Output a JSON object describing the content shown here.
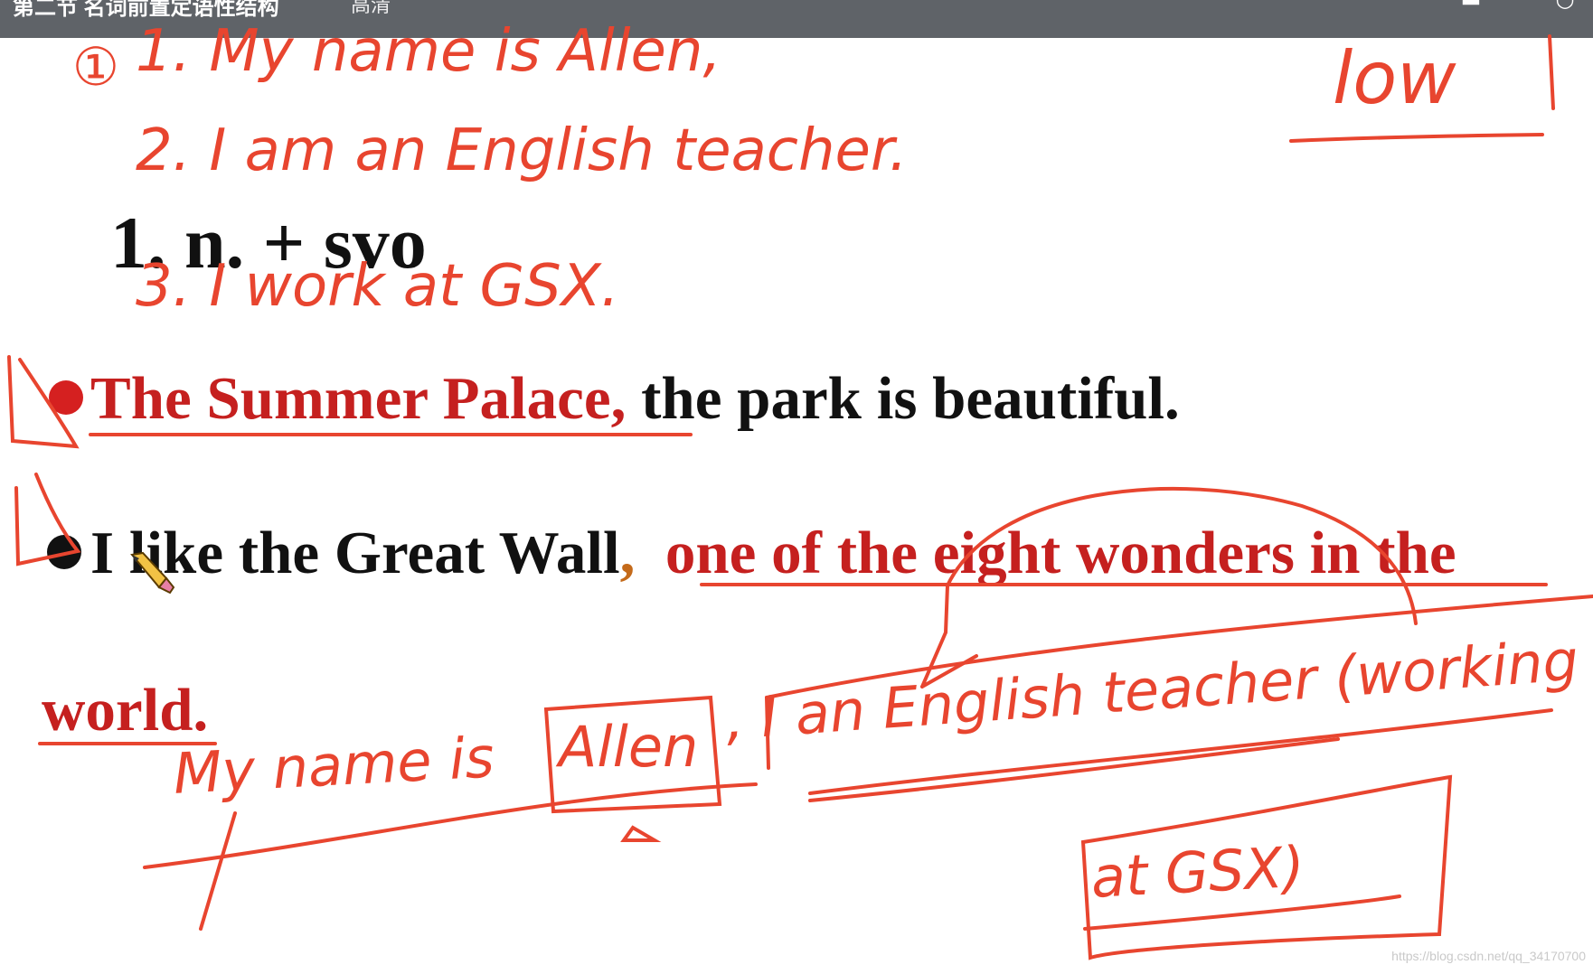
{
  "titlebar": {
    "title": "第二节 名词前置定语性结构",
    "mode": "高清",
    "controls": [
      "minimize-icon",
      "close-icon"
    ]
  },
  "slide": {
    "heading": "1.  n. + svo",
    "sentence1": {
      "red_part": "The Summer Palace, ",
      "black_part": "the park is beautiful."
    },
    "sentence2": {
      "black_part": "I like the Great Wall",
      "comma": ",",
      "red_part": "one of the eight wonders in the"
    },
    "sentence3": {
      "red_part": "world."
    }
  },
  "annotations": {
    "line1": "1. My name is Allen,",
    "line1_num": "①",
    "line2": "2. I am an English teacher.",
    "line3": "3. I work at GSX.",
    "low": "low",
    "combined_a": "My name is",
    "combined_box": "Allen",
    "combined_b": ", I an English teacher (working",
    "combined_c": "at GSX)",
    "ink_color": "#e8452f"
  },
  "watermark": "https://blog.csdn.net/qq_34170700"
}
